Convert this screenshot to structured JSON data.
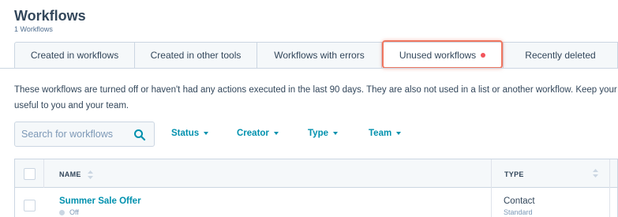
{
  "header": {
    "title": "Workflows",
    "subtitle": "1 Workflows"
  },
  "tabs": [
    {
      "label": "Created in workflows",
      "active": false
    },
    {
      "label": "Created in other tools",
      "active": false
    },
    {
      "label": "Workflows with errors",
      "active": false
    },
    {
      "label": "Unused workflows",
      "active": true,
      "has_indicator": true
    },
    {
      "label": "Recently deleted",
      "active": false
    }
  ],
  "description": {
    "line1": "These workflows are turned off or haven't had any actions executed in the last 90 days. They are also not used in a list or another workflow. Keep your l",
    "line2": "useful to you and your team."
  },
  "search": {
    "placeholder": "Search for workflows",
    "value": ""
  },
  "filters": {
    "status": "Status",
    "creator": "Creator",
    "type": "Type",
    "team": "Team"
  },
  "table": {
    "columns": {
      "name": "NAME",
      "type": "TYPE"
    },
    "rows": [
      {
        "name": "Summer Sale Offer",
        "status": "Off",
        "type": "Contact",
        "subtype": "Standard"
      }
    ]
  },
  "colors": {
    "accent": "#0091ae",
    "text": "#33475b",
    "muted": "#7c98b6",
    "border": "#cbd6e2",
    "indicator": "#f2545b",
    "highlight": "#f0765f"
  }
}
